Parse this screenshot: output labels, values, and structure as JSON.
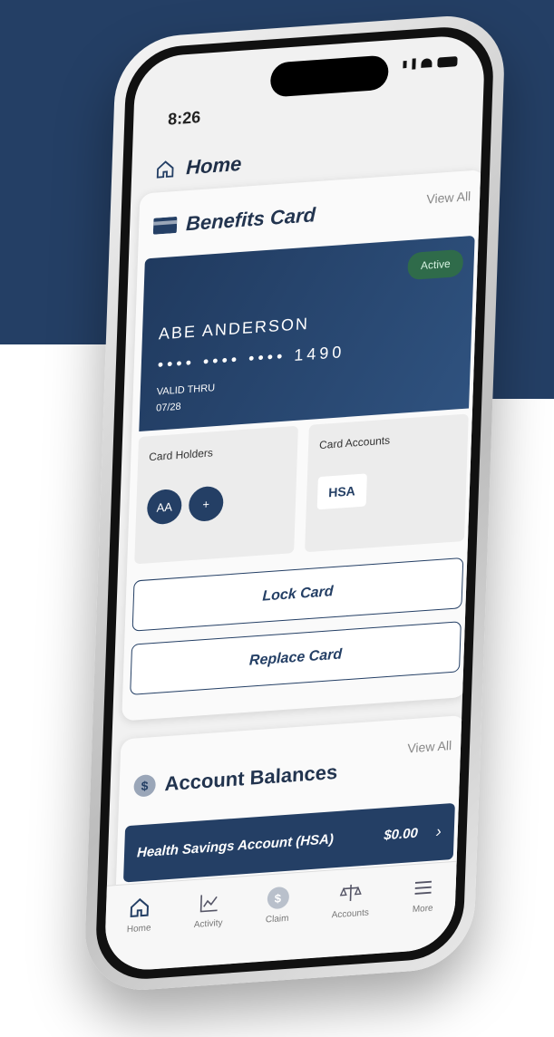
{
  "status_bar": {
    "time": "8:26"
  },
  "header": {
    "title": "Home"
  },
  "benefits_card": {
    "title": "Benefits Card",
    "view_all": "View All",
    "status": "Active",
    "holder_name": "ABE ANDERSON",
    "card_number": "•••• •••• •••• 1490",
    "valid_thru_label": "VALID THRU",
    "valid_thru": "07/28",
    "card_holders_label": "Card Holders",
    "holder_initials": "AA",
    "add_holder": "+",
    "card_accounts_label": "Card Accounts",
    "account_chip": "HSA",
    "lock_label": "Lock Card",
    "replace_label": "Replace Card"
  },
  "account_balances": {
    "title": "Account Balances",
    "view_all": "View All",
    "account_name": "Health Savings Account (HSA)",
    "amount": "$0.00",
    "chevron": "›"
  },
  "tabbar": {
    "items": [
      {
        "label": "Home"
      },
      {
        "label": "Activity"
      },
      {
        "label": "Claim"
      },
      {
        "label": "Accounts"
      },
      {
        "label": "More"
      }
    ]
  },
  "colors": {
    "navy": "#243f65",
    "active_badge": "#2f6b4a"
  }
}
